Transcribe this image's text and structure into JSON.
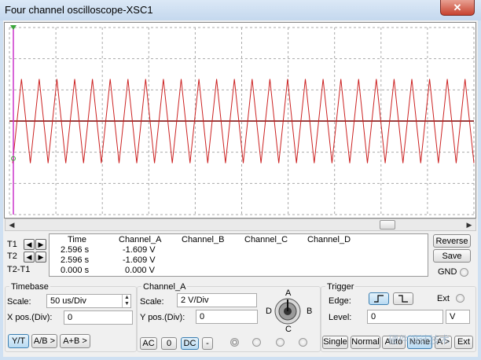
{
  "window": {
    "title": "Four channel oscilloscope-XSC1",
    "close_glyph": "✕"
  },
  "screen": {
    "trace_color": "#cc2222",
    "baseline_color": "#7a0000",
    "cursor_color": "#cc33cc",
    "grid_color": "#aaaaaa",
    "trace": {
      "cycles": 26,
      "high": 1.35,
      "low": -1.35
    }
  },
  "measure": {
    "headers": {
      "time": "Time",
      "ch_a": "Channel_A",
      "ch_b": "Channel_B",
      "ch_c": "Channel_C",
      "ch_d": "Channel_D"
    },
    "rows": [
      {
        "label": "T1",
        "time": "2.596 s",
        "ch_a": "-1.609 V"
      },
      {
        "label": "T2",
        "time": "2.596 s",
        "ch_a": "-1.609 V"
      },
      {
        "label": "T2-T1",
        "time": "0.000 s",
        "ch_a": "0.000 V"
      }
    ]
  },
  "side": {
    "reverse": "Reverse",
    "save": "Save",
    "gnd": "GND"
  },
  "timebase": {
    "title": "Timebase",
    "scale_label": "Scale:",
    "scale_value": "50 us/Div",
    "xpos_label": "X pos.(Div):",
    "xpos_value": "0",
    "modes": [
      "Y/T",
      "A/B >",
      "A+B >"
    ]
  },
  "channel": {
    "title": "Channel_A",
    "scale_label": "Scale:",
    "scale_value": "2  V/Div",
    "ypos_label": "Y pos.(Div):",
    "ypos_value": "0",
    "coupling": [
      "AC",
      "0",
      "DC",
      "-"
    ],
    "knob": {
      "a": "A",
      "b": "B",
      "c": "C",
      "d": "D"
    }
  },
  "trigger": {
    "title": "Trigger",
    "edge_label": "Edge:",
    "ext_label": "Ext",
    "level_label": "Level:",
    "level_value": "0",
    "level_unit": "V",
    "modes": [
      "Single",
      "Normal",
      "Auto",
      "None",
      "A >",
      "Ext"
    ]
  },
  "watermark": {
    "text": "硬件设计技术"
  }
}
